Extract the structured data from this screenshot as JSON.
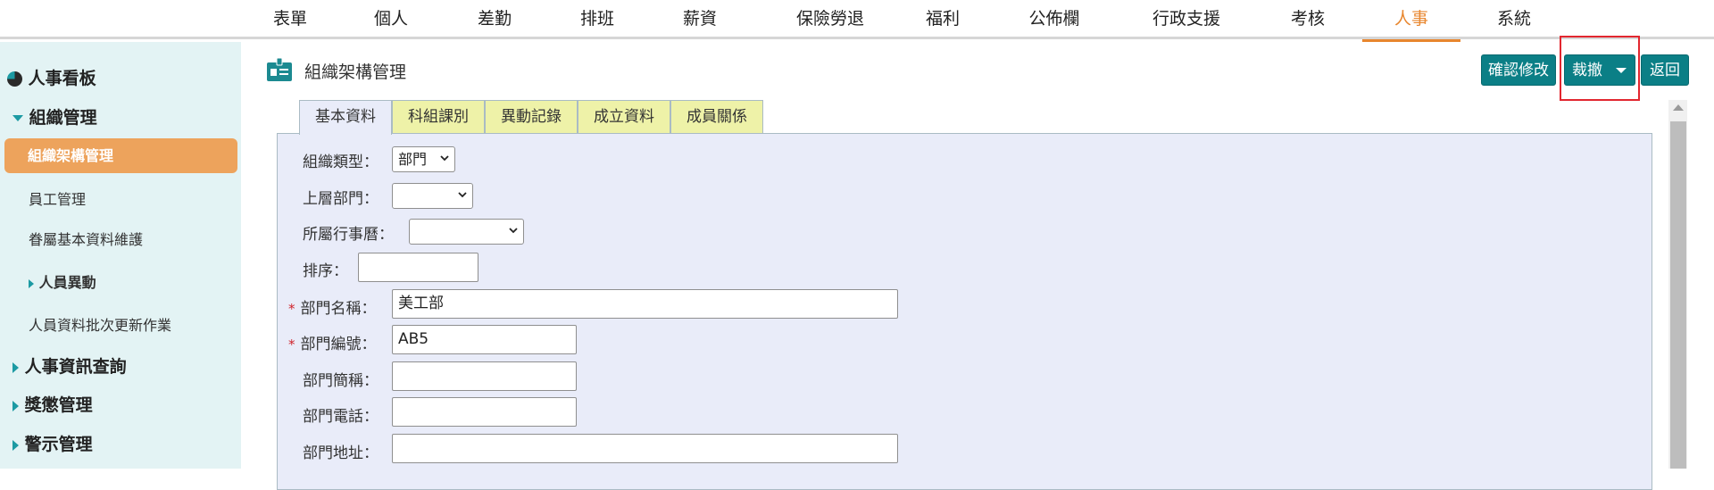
{
  "topnav": {
    "items": [
      "表單",
      "個人",
      "差勤",
      "排班",
      "薪資",
      "保險勞退",
      "福利",
      "公佈欄",
      "行政支援",
      "考核",
      "人事",
      "系統"
    ],
    "active_index": 10,
    "active_color": "#e8862e"
  },
  "sidebar": {
    "dashboard": "人事看板",
    "org_mgmt": "組織管理",
    "org_chart_mgmt": "組織架構管理",
    "employee_mgmt": "員工管理",
    "dependent_data": "眷屬基本資料維護",
    "personnel_change": "人員異動",
    "batch_update": "人員資料批次更新作業",
    "hr_query": "人事資訊查詢",
    "reward_mgmt": "獎懲管理",
    "warning_mgmt": "警示管理"
  },
  "header": {
    "title": "組織架構管理",
    "confirm_label": "確認修改",
    "abolish_label": "裁撤",
    "back_label": "返回",
    "button_color": "#0b7f86"
  },
  "tabs": [
    "基本資料",
    "科組課別",
    "異動記錄",
    "成立資料",
    "成員關係"
  ],
  "form": {
    "org_type_label": "組織類型：",
    "org_type_value": "部門",
    "parent_dept_label": "上層部門：",
    "parent_dept_value": "",
    "calendar_label": "所屬行事曆：",
    "calendar_value": "",
    "sort_label": "排序：",
    "sort_value": "",
    "dept_name_label": "部門名稱：",
    "dept_name_value": "美工部",
    "dept_code_label": "部門編號：",
    "dept_code_value": "AB5",
    "dept_abbr_label": "部門簡稱：",
    "dept_abbr_value": "",
    "dept_phone_label": "部門電話：",
    "dept_phone_value": "",
    "dept_address_label": "部門地址：",
    "dept_address_value": "",
    "required_mark": "*"
  }
}
